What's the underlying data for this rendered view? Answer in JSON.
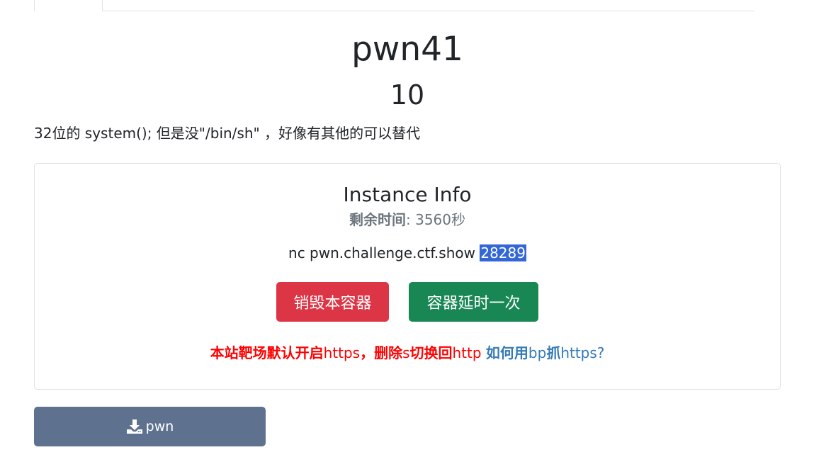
{
  "challenge": {
    "title": "pwn41",
    "points": "10",
    "description": "32位的 system(); 但是没\"/bin/sh\" ，好像有其他的可以替代"
  },
  "instance": {
    "title": "Instance Info",
    "time_label": "剩余时间",
    "time_sep": ": ",
    "time_value": "3560秒",
    "conn_prefix": "nc pwn.challenge.ctf.show ",
    "port": "28289",
    "destroy_label": "销毁本容器",
    "extend_label": "容器延时一次",
    "colors": {
      "destroy": "#dc3545",
      "extend": "#198754",
      "port_highlight": "#3367d6"
    }
  },
  "notice": {
    "part1_bold": "本站靶场默认开启",
    "part1_plain": "https",
    "part2_bold": "，删除",
    "part2_plain": "s",
    "part3_bold": "切换回",
    "part3_plain": "http",
    "gap": " ",
    "link_bold_1": "如何用",
    "link_plain_1": "bp",
    "link_bold_2": "抓",
    "link_plain_2": "https?"
  },
  "download": {
    "icon": "download-icon",
    "label": "pwn",
    "color": "#5e7290"
  }
}
